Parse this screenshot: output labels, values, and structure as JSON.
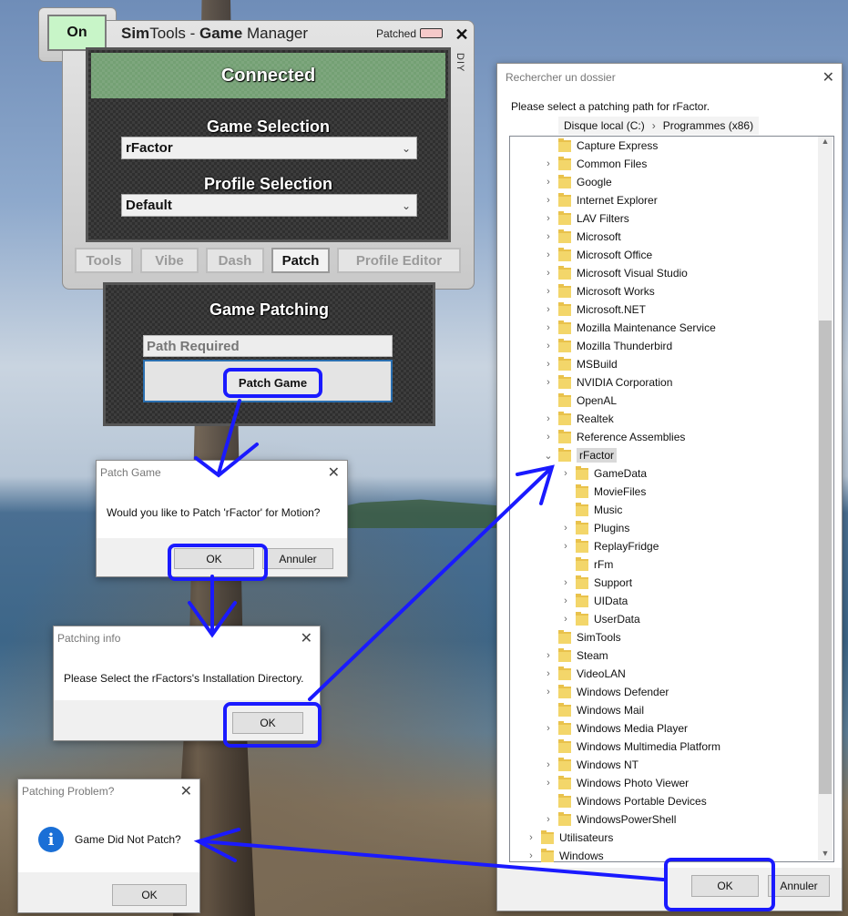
{
  "simtools": {
    "on_label": "On",
    "title_bold1": "Sim",
    "title_plain1": "Tools - ",
    "title_bold2": "Game",
    "title_plain2": " Manager",
    "patched_label": "Patched",
    "close_symbol": "✕",
    "diy_label": "DIY",
    "status": "Connected",
    "game_selection_label": "Game Selection",
    "game_selected": "rFactor",
    "profile_selection_label": "Profile Selection",
    "profile_selected": "Default",
    "tabs": [
      "Tools",
      "Vibe",
      "Dash",
      "Patch",
      "Profile Editor"
    ],
    "active_tab": "Patch",
    "patching_heading": "Game Patching",
    "path_placeholder": "Path Required",
    "patch_button": "Patch Game"
  },
  "dialog_patch_game": {
    "title": "Patch Game",
    "message": "Would you like to Patch 'rFactor' for Motion?",
    "ok": "OK",
    "cancel": "Annuler"
  },
  "dialog_patching_info": {
    "title": "Patching info",
    "message": "Please Select the rFactors's Installation Directory.",
    "ok": "OK"
  },
  "dialog_patching_problem": {
    "title": "Patching Problem?",
    "message": "Game Did Not Patch?",
    "ok": "OK",
    "icon": "info-icon"
  },
  "folder_browser": {
    "title": "Rechercher un dossier",
    "instruction": "Please select a patching path for rFactor.",
    "breadcrumb": [
      "Disque local (C:)",
      "Programmes (x86)"
    ],
    "items": [
      {
        "label": "Capture Express",
        "level": 1,
        "expandable": false
      },
      {
        "label": "Common Files",
        "level": 1,
        "expandable": true
      },
      {
        "label": "Google",
        "level": 1,
        "expandable": true
      },
      {
        "label": "Internet Explorer",
        "level": 1,
        "expandable": true
      },
      {
        "label": "LAV Filters",
        "level": 1,
        "expandable": true
      },
      {
        "label": "Microsoft",
        "level": 1,
        "expandable": true
      },
      {
        "label": "Microsoft Office",
        "level": 1,
        "expandable": true
      },
      {
        "label": "Microsoft Visual Studio",
        "level": 1,
        "expandable": true
      },
      {
        "label": "Microsoft Works",
        "level": 1,
        "expandable": true
      },
      {
        "label": "Microsoft.NET",
        "level": 1,
        "expandable": true
      },
      {
        "label": "Mozilla Maintenance Service",
        "level": 1,
        "expandable": true
      },
      {
        "label": "Mozilla Thunderbird",
        "level": 1,
        "expandable": true
      },
      {
        "label": "MSBuild",
        "level": 1,
        "expandable": true
      },
      {
        "label": "NVIDIA Corporation",
        "level": 1,
        "expandable": true
      },
      {
        "label": "OpenAL",
        "level": 1,
        "expandable": false
      },
      {
        "label": "Realtek",
        "level": 1,
        "expandable": true
      },
      {
        "label": "Reference Assemblies",
        "level": 1,
        "expandable": true
      },
      {
        "label": "rFactor",
        "level": 1,
        "expandable": "open",
        "selected": true
      },
      {
        "label": "GameData",
        "level": 2,
        "expandable": true
      },
      {
        "label": "MovieFiles",
        "level": 2,
        "expandable": false
      },
      {
        "label": "Music",
        "level": 2,
        "expandable": false
      },
      {
        "label": "Plugins",
        "level": 2,
        "expandable": true
      },
      {
        "label": "ReplayFridge",
        "level": 2,
        "expandable": true
      },
      {
        "label": "rFm",
        "level": 2,
        "expandable": false
      },
      {
        "label": "Support",
        "level": 2,
        "expandable": true
      },
      {
        "label": "UIData",
        "level": 2,
        "expandable": true
      },
      {
        "label": "UserData",
        "level": 2,
        "expandable": true
      },
      {
        "label": "SimTools",
        "level": 1,
        "expandable": false
      },
      {
        "label": "Steam",
        "level": 1,
        "expandable": true
      },
      {
        "label": "VideoLAN",
        "level": 1,
        "expandable": true
      },
      {
        "label": "Windows Defender",
        "level": 1,
        "expandable": true
      },
      {
        "label": "Windows Mail",
        "level": 1,
        "expandable": false
      },
      {
        "label": "Windows Media Player",
        "level": 1,
        "expandable": true
      },
      {
        "label": "Windows Multimedia Platform",
        "level": 1,
        "expandable": false
      },
      {
        "label": "Windows NT",
        "level": 1,
        "expandable": true
      },
      {
        "label": "Windows Photo Viewer",
        "level": 1,
        "expandable": true
      },
      {
        "label": "Windows Portable Devices",
        "level": 1,
        "expandable": false
      },
      {
        "label": "WindowsPowerShell",
        "level": 1,
        "expandable": true
      },
      {
        "label": "Utilisateurs",
        "level": 0,
        "expandable": true
      },
      {
        "label": "Windows",
        "level": 0,
        "expandable": true
      }
    ],
    "ok": "OK",
    "cancel": "Annuler"
  },
  "colors": {
    "highlight": "#1a1aff",
    "connected_green": "#7ea77e",
    "on_green": "#c8f5c8",
    "patched_indicator": "#f5c9c9"
  }
}
